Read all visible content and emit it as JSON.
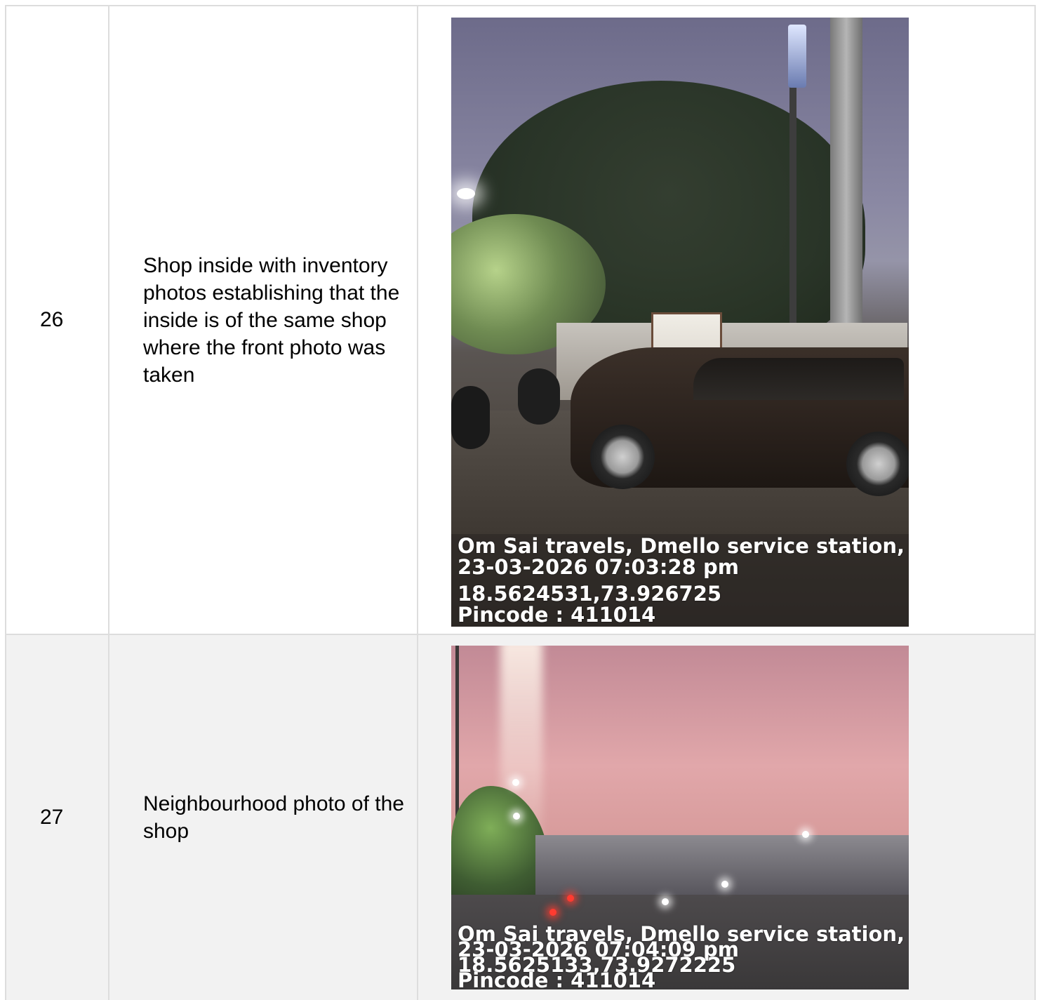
{
  "rows": [
    {
      "number": "26",
      "description": "Shop inside with inventory photos establishing that the inside is of the same shop where the front photo was taken",
      "photo": {
        "location": "Om Sai travels, Dmello service station, ...",
        "datetime": "23-03-2026 07:03:28 pm",
        "coordinates": "18.5624531,73.926725",
        "pincode": "Pincode : 411014"
      }
    },
    {
      "number": "27",
      "description": "Neighbourhood photo of the shop",
      "photo": {
        "location": "Om Sai travels, Dmello service station, ...",
        "datetime": "23-03-2026 07:04:09 pm",
        "coordinates": "18.5625133,73.9272225",
        "pincode": "Pincode : 411014"
      }
    }
  ]
}
